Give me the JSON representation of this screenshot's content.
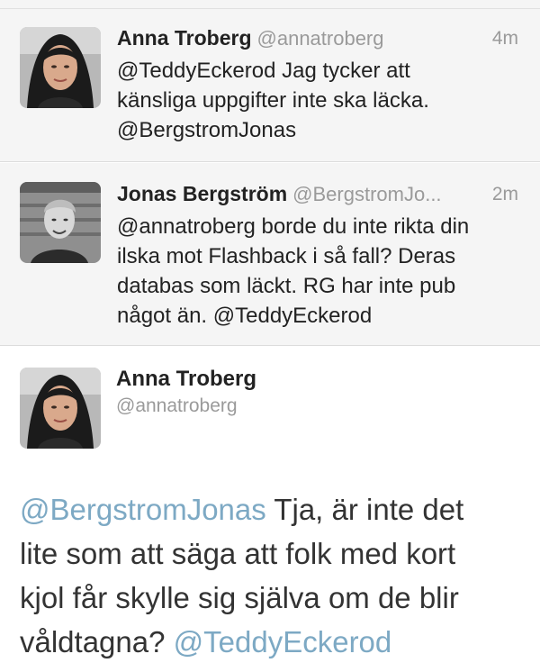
{
  "tweets": [
    {
      "name": "Anna Troberg",
      "handle": "@annatroberg",
      "time": "4m",
      "text_lines": [
        "@TeddyEckerod Jag tycker att",
        "känsliga uppgifter inte ska läcka.",
        "@BergstromJonas"
      ]
    },
    {
      "name": "Jonas Bergström",
      "handle": "@BergstromJo...",
      "time": "2m",
      "text_lines": [
        "@annatroberg borde du inte rikta din",
        "ilska mot Flashback i så fall? Deras",
        "databas som läckt. RG har inte pub",
        "något än. @TeddyEckerod"
      ]
    }
  ],
  "main_tweet": {
    "name": "Anna Troberg",
    "handle": "@annatroberg",
    "lines": [
      {
        "mention": "@BergstromJonas",
        "text": " Tja, är inte det"
      },
      {
        "text": "lite som att säga att folk med kort"
      },
      {
        "text": "kjol får skylle sig själva om de blir"
      },
      {
        "text": "våldtagna? ",
        "mention_after": "@TeddyEckerod"
      }
    ]
  },
  "colors": {
    "mention": "#7da9c4",
    "reply_background": "#f5f5f5"
  }
}
